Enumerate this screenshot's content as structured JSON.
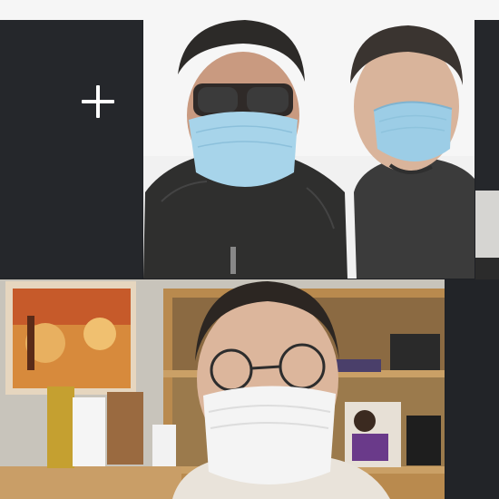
{
  "call": {
    "add_participant_icon": "plus-icon",
    "participants": [
      {
        "tile": "top-main",
        "description_icon": "video-feed"
      },
      {
        "tile": "bottom-main",
        "description_icon": "video-feed"
      }
    ]
  },
  "colors": {
    "tile_background": "#25272b",
    "top_bar": "#f6f6f6",
    "add_icon": "#ffffff"
  }
}
